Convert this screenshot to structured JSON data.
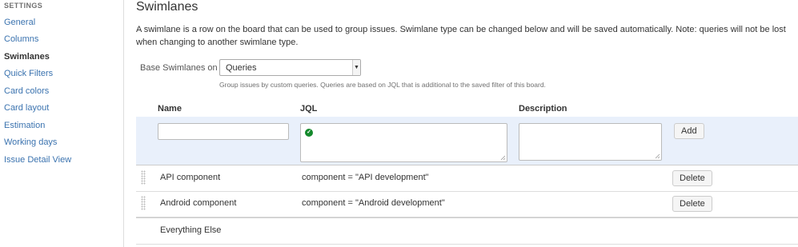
{
  "sidebar": {
    "heading": "SETTINGS",
    "items": [
      {
        "label": "General",
        "active": false
      },
      {
        "label": "Columns",
        "active": false
      },
      {
        "label": "Swimlanes",
        "active": true
      },
      {
        "label": "Quick Filters",
        "active": false
      },
      {
        "label": "Card colors",
        "active": false
      },
      {
        "label": "Card layout",
        "active": false
      },
      {
        "label": "Estimation",
        "active": false
      },
      {
        "label": "Working days",
        "active": false
      },
      {
        "label": "Issue Detail View",
        "active": false
      }
    ]
  },
  "main": {
    "title": "Swimlanes",
    "description": "A swimlane is a row on the board that can be used to group issues. Swimlane type can be changed below and will be saved automatically. Note: queries will not be lost when changing to another swimlane type.",
    "base_label": "Base Swimlanes on",
    "base_value": "Queries",
    "help_text": "Group issues by custom queries. Queries are based on JQL that is additional to the saved filter of this board.",
    "columns": {
      "name": "Name",
      "jql": "JQL",
      "description": "Description"
    },
    "add_row": {
      "name_value": "",
      "jql_value": "",
      "description_value": "",
      "jql_status_icon": "valid-check-icon",
      "add_label": "Add"
    },
    "rows": [
      {
        "name": "API component",
        "jql": "component = \"API development\"",
        "description": "",
        "action": "Delete"
      },
      {
        "name": "Android component",
        "jql": "component = \"Android development\"",
        "description": "",
        "action": "Delete"
      },
      {
        "name": "Everything Else",
        "jql": "",
        "description": ""
      }
    ]
  },
  "colors": {
    "link": "#3b73af",
    "add_row_bg": "#e9f0fb",
    "valid": "#14892c"
  }
}
